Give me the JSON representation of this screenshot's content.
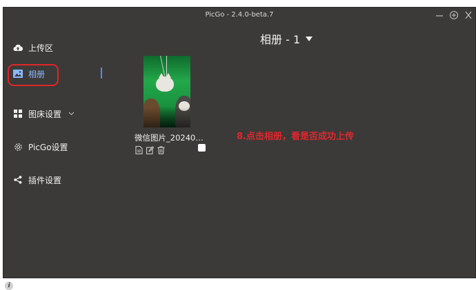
{
  "window": {
    "title": "PicGo - 2.4.0-beta.7"
  },
  "titlebar_controls": [
    "minimize-icon",
    "pin-icon",
    "close-icon"
  ],
  "sidebar": {
    "items": [
      {
        "label": "上传区",
        "icon": "cloud-upload-icon"
      },
      {
        "label": "相册",
        "icon": "image-icon",
        "active": true
      },
      {
        "label": "图床设置",
        "icon": "grid-icon",
        "has_chevron": true
      },
      {
        "label": "PicGo设置",
        "icon": "gear-icon"
      },
      {
        "label": "插件设置",
        "icon": "share-icon"
      }
    ]
  },
  "album": {
    "title": "相册 - 1",
    "items": [
      {
        "filename": "微信图片_20240…"
      }
    ]
  },
  "annotation": {
    "text": "8.点击相册，看是否成功上传"
  },
  "colors": {
    "background": "#3c3a38",
    "accent": "#4b8ff0",
    "annotation": "#e3262b"
  }
}
